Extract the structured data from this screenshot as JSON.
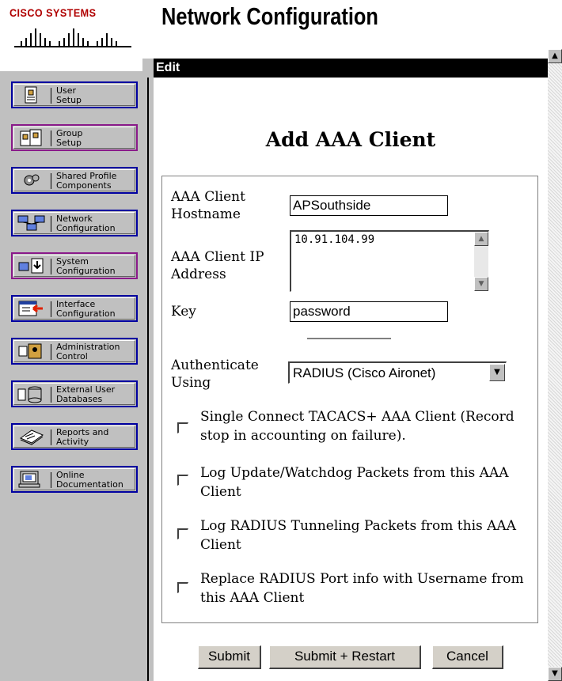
{
  "brand": {
    "name": "Cisco Systems"
  },
  "header": {
    "title": "Network Configuration"
  },
  "sidebar": {
    "items": [
      {
        "label": "User\nSetup",
        "icon": "user-setup-icon"
      },
      {
        "label": "Group\nSetup",
        "icon": "group-setup-icon"
      },
      {
        "label": "Shared Profile\nComponents",
        "icon": "shared-profile-icon"
      },
      {
        "label": "Network\nConfiguration",
        "icon": "network-config-icon"
      },
      {
        "label": "System\nConfiguration",
        "icon": "system-config-icon"
      },
      {
        "label": "Interface\nConfiguration",
        "icon": "interface-config-icon"
      },
      {
        "label": "Administration\nControl",
        "icon": "admin-control-icon"
      },
      {
        "label": "External User\nDatabases",
        "icon": "external-db-icon"
      },
      {
        "label": "Reports and\nActivity",
        "icon": "reports-icon"
      },
      {
        "label": "Online\nDocumentation",
        "icon": "documentation-icon"
      }
    ]
  },
  "frame": {
    "bar_label": "Edit"
  },
  "form": {
    "heading": "Add AAA Client",
    "hostname_label": "AAA Client Hostname",
    "hostname_value": "APSouthside",
    "ip_label": "AAA Client IP Address",
    "ip_value": "10.91.104.99",
    "key_label": "Key",
    "key_value": "password",
    "auth_label": "Authenticate Using",
    "auth_value": "RADIUS (Cisco Aironet)",
    "checkboxes": [
      {
        "label": "Single Connect TACACS+ AAA Client (Record stop in accounting on failure).",
        "checked": false
      },
      {
        "label": "Log Update/Watchdog Packets from this AAA Client",
        "checked": false
      },
      {
        "label": "Log RADIUS Tunneling Packets from this AAA Client",
        "checked": false
      },
      {
        "label": "Replace RADIUS Port info with Username from this AAA Client",
        "checked": false
      }
    ]
  },
  "buttons": {
    "submit": "Submit",
    "submit_restart": "Submit + Restart",
    "cancel": "Cancel"
  },
  "colors": {
    "nav_border_blue": "#0000a0",
    "nav_border_purple": "#8a1a8a",
    "brand_red": "#b00000",
    "sidebar_bg": "#c0c0c0"
  }
}
